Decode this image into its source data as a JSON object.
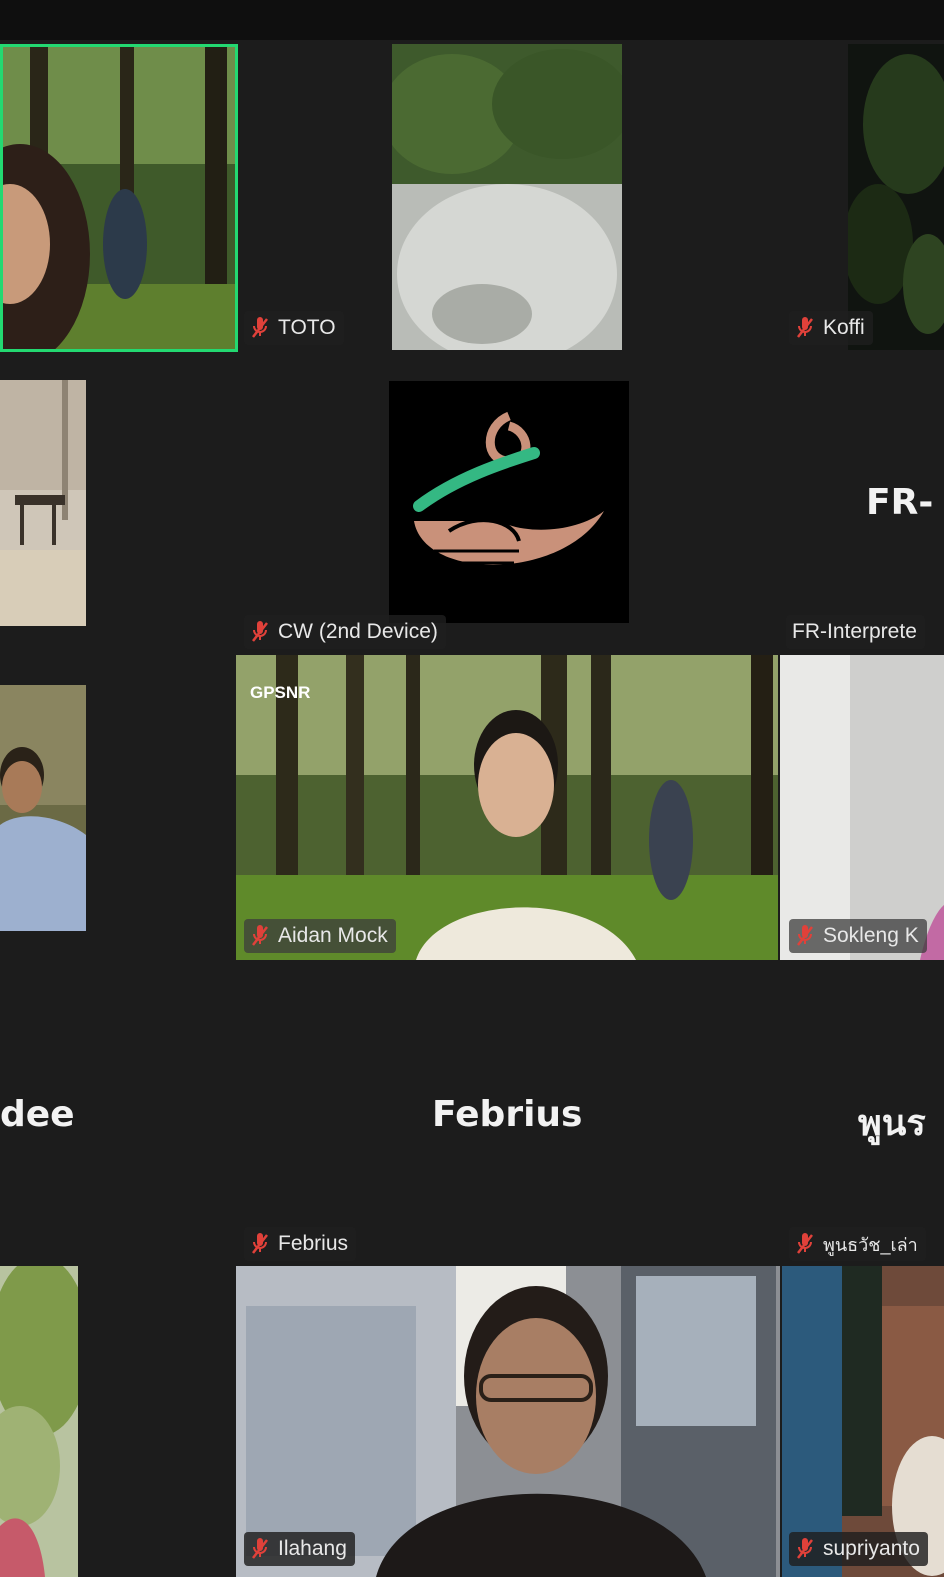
{
  "participants": {
    "toto": "TOTO",
    "koffi": "Koffi",
    "cw": "CW (2nd Device)",
    "fr_interpreter": "FR-Interprete",
    "fr_big": "FR-",
    "aidan": "Aidan Mock",
    "sokleng": "Sokleng K",
    "dee_big": "dee",
    "febrius_big": "Febrius",
    "febrius": "Febrius",
    "thai_big": "พูนร",
    "thai": "พูนธวัช_เล่า",
    "ilahang": "Ilahang",
    "supriyanto": "supriyanto"
  },
  "logo": {
    "text": "GPSNR"
  },
  "colors": {
    "active_speaker": "#23d971",
    "muted_icon": "#e0413a",
    "background": "#1c1c1c"
  }
}
